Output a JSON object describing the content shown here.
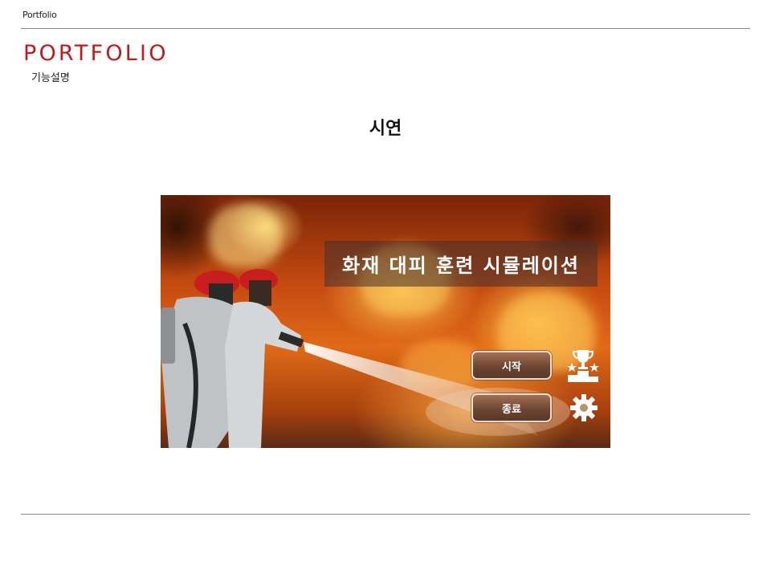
{
  "header": {
    "label": "Portfolio",
    "brand": "PORTFOLIO",
    "subtitle": "기능설명"
  },
  "section": {
    "title": "시연"
  },
  "game_screen": {
    "title": "화재 대피 훈련 시뮬레이션",
    "buttons": [
      {
        "label": "시작"
      },
      {
        "label": "종료"
      }
    ],
    "icons": [
      "ranking-trophy-icon",
      "settings-gear-icon"
    ]
  },
  "colors": {
    "brand_red": "#c21a1a",
    "button_brown": "#6e4633"
  }
}
